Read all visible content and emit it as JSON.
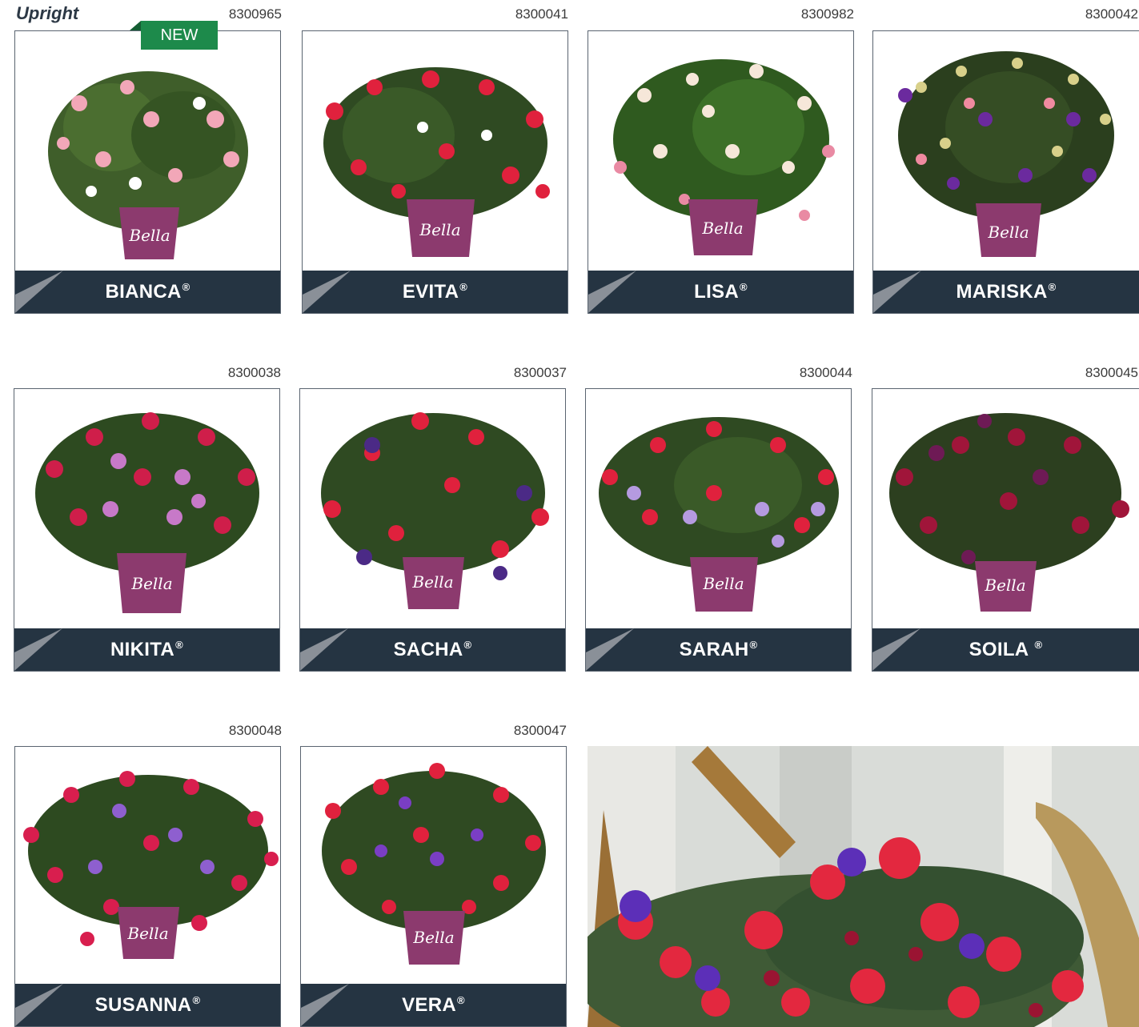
{
  "section_title": "Upright",
  "badge": {
    "text": "NEW",
    "color": "#1d8a4b"
  },
  "colors": {
    "label_bar": "#253442",
    "section_title": "#2c3845"
  },
  "products": [
    {
      "sku": "8300965",
      "name": "BIANCA",
      "mark": "®",
      "icon": "pink-white-fuchsia-plant"
    },
    {
      "sku": "8300041",
      "name": "EVITA",
      "mark": "®",
      "icon": "red-white-fuchsia-plant"
    },
    {
      "sku": "8300982",
      "name": "LISA",
      "mark": "®",
      "icon": "white-pink-fuchsia-plant"
    },
    {
      "sku": "8300042",
      "name": "MARISKA",
      "mark": "®",
      "icon": "purple-pink-fuchsia-plant"
    },
    {
      "sku": "8300038",
      "name": "NIKITA",
      "mark": "®",
      "icon": "red-violet-fuchsia-plant"
    },
    {
      "sku": "8300037",
      "name": "SACHA",
      "mark": "®",
      "icon": "red-purple-fuchsia-plant"
    },
    {
      "sku": "8300044",
      "name": "SARAH",
      "mark": "®",
      "icon": "red-lilac-fuchsia-plant"
    },
    {
      "sku": "8300045",
      "name": "SOILA ",
      "mark": "®",
      "icon": "deep-red-fuchsia-plant"
    },
    {
      "sku": "8300048",
      "name": "SUSANNA",
      "mark": "®",
      "icon": "red-purple-bud-fuchsia-plant"
    },
    {
      "sku": "8300047",
      "name": "VERA",
      "mark": "®",
      "icon": "red-violet-bud-fuchsia-plant"
    }
  ],
  "lifestyle_photo": {
    "icon": "fuchsia-basket-closeup-photo"
  }
}
